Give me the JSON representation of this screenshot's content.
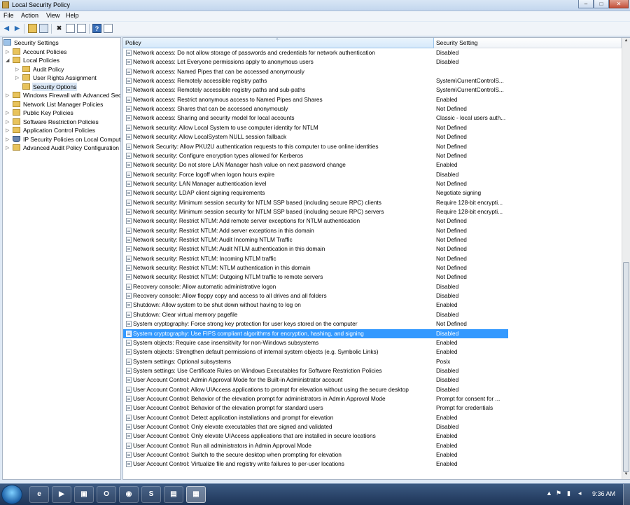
{
  "window": {
    "title": "Local Security Policy",
    "controls": {
      "minimize": "–",
      "maximize": "□",
      "close": "✕"
    }
  },
  "menu": {
    "file": "File",
    "action": "Action",
    "view": "View",
    "help": "Help"
  },
  "toolbar": {
    "back": "◀",
    "forward": "▶",
    "delete": "✖",
    "help": "?"
  },
  "tree": {
    "root": "Security Settings",
    "items": [
      {
        "label": "Account Policies",
        "icon": "folder-icon",
        "expander": "▷"
      },
      {
        "label": "Local Policies",
        "icon": "folder-icon",
        "expander": "◢"
      },
      {
        "label": "Audit Policy",
        "icon": "folder-icon",
        "expander": "▷"
      },
      {
        "label": "User Rights Assignment",
        "icon": "folder-icon",
        "expander": "▷"
      },
      {
        "label": "Security Options",
        "icon": "folder-icon",
        "expander": ""
      },
      {
        "label": "Windows Firewall with Advanced Security",
        "icon": "folder-icon",
        "expander": "▷"
      },
      {
        "label": "Network List Manager Policies",
        "icon": "folder-icon",
        "expander": ""
      },
      {
        "label": "Public Key Policies",
        "icon": "folder-icon",
        "expander": "▷"
      },
      {
        "label": "Software Restriction Policies",
        "icon": "folder-icon",
        "expander": "▷"
      },
      {
        "label": "Application Control Policies",
        "icon": "folder-icon",
        "expander": "▷"
      },
      {
        "label": "IP Security Policies on Local Computer",
        "icon": "shield-icon",
        "expander": "▷"
      },
      {
        "label": "Advanced Audit Policy Configuration",
        "icon": "folder-icon",
        "expander": "▷"
      }
    ]
  },
  "list": {
    "headers": {
      "policy": "Policy",
      "setting": "Security Setting"
    },
    "selected_index": 30,
    "rows": [
      {
        "policy": "Network access: Do not allow storage of passwords and credentials for network authentication",
        "setting": "Disabled"
      },
      {
        "policy": "Network access: Let Everyone permissions apply to anonymous users",
        "setting": "Disabled"
      },
      {
        "policy": "Network access: Named Pipes that can be accessed anonymously",
        "setting": ""
      },
      {
        "policy": "Network access: Remotely accessible registry paths",
        "setting": "System\\CurrentControlS..."
      },
      {
        "policy": "Network access: Remotely accessible registry paths and sub-paths",
        "setting": "System\\CurrentControlS..."
      },
      {
        "policy": "Network access: Restrict anonymous access to Named Pipes and Shares",
        "setting": "Enabled"
      },
      {
        "policy": "Network access: Shares that can be accessed anonymously",
        "setting": "Not Defined"
      },
      {
        "policy": "Network access: Sharing and security model for local accounts",
        "setting": "Classic - local users auth..."
      },
      {
        "policy": "Network security: Allow Local System to use computer identity for NTLM",
        "setting": "Not Defined"
      },
      {
        "policy": "Network security: Allow LocalSystem NULL session fallback",
        "setting": "Not Defined"
      },
      {
        "policy": "Network Security: Allow PKU2U authentication requests to this computer to use online identities",
        "setting": "Not Defined"
      },
      {
        "policy": "Network security: Configure encryption types allowed for Kerberos",
        "setting": "Not Defined"
      },
      {
        "policy": "Network security: Do not store LAN Manager hash value on next password change",
        "setting": "Enabled"
      },
      {
        "policy": "Network security: Force logoff when logon hours expire",
        "setting": "Disabled"
      },
      {
        "policy": "Network security: LAN Manager authentication level",
        "setting": "Not Defined"
      },
      {
        "policy": "Network security: LDAP client signing requirements",
        "setting": "Negotiate signing"
      },
      {
        "policy": "Network security: Minimum session security for NTLM SSP based (including secure RPC) clients",
        "setting": "Require 128-bit encrypti..."
      },
      {
        "policy": "Network security: Minimum session security for NTLM SSP based (including secure RPC) servers",
        "setting": "Require 128-bit encrypti..."
      },
      {
        "policy": "Network security: Restrict NTLM: Add remote server exceptions for NTLM authentication",
        "setting": "Not Defined"
      },
      {
        "policy": "Network security: Restrict NTLM: Add server exceptions in this domain",
        "setting": "Not Defined"
      },
      {
        "policy": "Network security: Restrict NTLM: Audit Incoming NTLM Traffic",
        "setting": "Not Defined"
      },
      {
        "policy": "Network security: Restrict NTLM: Audit NTLM authentication in this domain",
        "setting": "Not Defined"
      },
      {
        "policy": "Network security: Restrict NTLM: Incoming NTLM traffic",
        "setting": "Not Defined"
      },
      {
        "policy": "Network security: Restrict NTLM: NTLM authentication in this domain",
        "setting": "Not Defined"
      },
      {
        "policy": "Network security: Restrict NTLM: Outgoing NTLM traffic to remote servers",
        "setting": "Not Defined"
      },
      {
        "policy": "Recovery console: Allow automatic administrative logon",
        "setting": "Disabled"
      },
      {
        "policy": "Recovery console: Allow floppy copy and access to all drives and all folders",
        "setting": "Disabled"
      },
      {
        "policy": "Shutdown: Allow system to be shut down without having to log on",
        "setting": "Enabled"
      },
      {
        "policy": "Shutdown: Clear virtual memory pagefile",
        "setting": "Disabled"
      },
      {
        "policy": "System cryptography: Force strong key protection for user keys stored on the computer",
        "setting": "Not Defined"
      },
      {
        "policy": "System cryptography: Use FIPS compliant algorithms for encryption, hashing, and signing",
        "setting": "Disabled"
      },
      {
        "policy": "System objects: Require case insensitivity for non-Windows subsystems",
        "setting": "Enabled"
      },
      {
        "policy": "System objects: Strengthen default permissions of internal system objects (e.g. Symbolic Links)",
        "setting": "Enabled"
      },
      {
        "policy": "System settings: Optional subsystems",
        "setting": "Posix"
      },
      {
        "policy": "System settings: Use Certificate Rules on Windows Executables for Software Restriction Policies",
        "setting": "Disabled"
      },
      {
        "policy": "User Account Control: Admin Approval Mode for the Built-in Administrator account",
        "setting": "Disabled"
      },
      {
        "policy": "User Account Control: Allow UIAccess applications to prompt for elevation without using the secure desktop",
        "setting": "Disabled"
      },
      {
        "policy": "User Account Control: Behavior of the elevation prompt for administrators in Admin Approval Mode",
        "setting": "Prompt for consent for ..."
      },
      {
        "policy": "User Account Control: Behavior of the elevation prompt for standard users",
        "setting": "Prompt for credentials"
      },
      {
        "policy": "User Account Control: Detect application installations and prompt for elevation",
        "setting": "Enabled"
      },
      {
        "policy": "User Account Control: Only elevate executables that are signed and validated",
        "setting": "Disabled"
      },
      {
        "policy": "User Account Control: Only elevate UIAccess applications that are installed in secure locations",
        "setting": "Enabled"
      },
      {
        "policy": "User Account Control: Run all administrators in Admin Approval Mode",
        "setting": "Enabled"
      },
      {
        "policy": "User Account Control: Switch to the secure desktop when prompting for elevation",
        "setting": "Enabled"
      },
      {
        "policy": "User Account Control: Virtualize file and registry write failures to per-user locations",
        "setting": "Enabled"
      }
    ]
  },
  "taskbar": {
    "buttons": [
      {
        "name": "ie-taskbar-button",
        "glyph": "e"
      },
      {
        "name": "media-player-taskbar-button",
        "glyph": "▶"
      },
      {
        "name": "computer-taskbar-button",
        "glyph": "▣"
      },
      {
        "name": "outlook-taskbar-button",
        "glyph": "O"
      },
      {
        "name": "chrome-taskbar-button",
        "glyph": "◉"
      },
      {
        "name": "skype-taskbar-button",
        "glyph": "S"
      },
      {
        "name": "explorer-taskbar-button",
        "glyph": "▤"
      },
      {
        "name": "local-security-policy-taskbar-button",
        "glyph": "▦"
      }
    ],
    "tray_chevron": "▲",
    "clock": "9:36 AM"
  }
}
